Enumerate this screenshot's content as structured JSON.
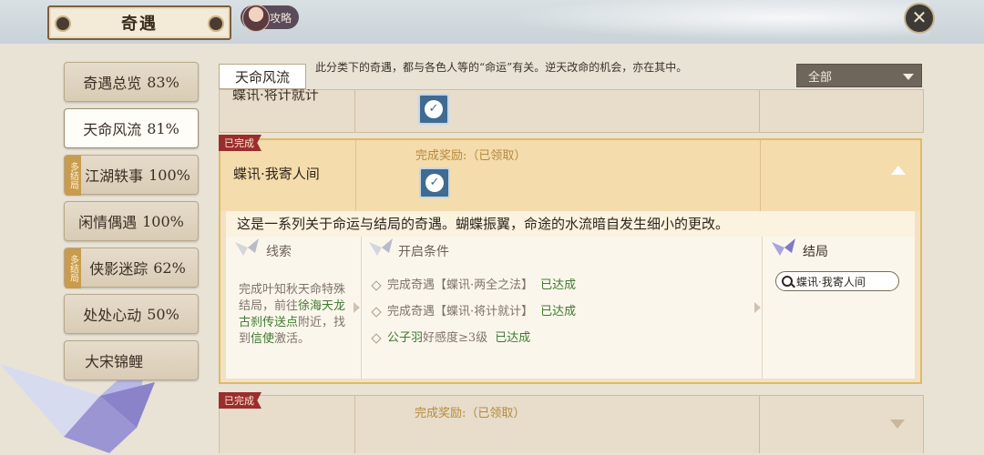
{
  "window": {
    "title": "奇遇",
    "guide_label": "攻略",
    "close_label": "✕"
  },
  "categories": [
    {
      "label": "奇遇总览",
      "pct": "83%",
      "tag": ""
    },
    {
      "label": "天命风流",
      "pct": "81%",
      "tag": "",
      "active": true
    },
    {
      "label": "江湖轶事",
      "pct": "100%",
      "tag": "多结局"
    },
    {
      "label": "闲情偶遇",
      "pct": "100%",
      "tag": ""
    },
    {
      "label": "侠影迷踪",
      "pct": "62%",
      "tag": "多结局"
    },
    {
      "label": "处处心动",
      "pct": "50%",
      "tag": ""
    },
    {
      "label": "大宋锦鲤",
      "pct": "",
      "tag": ""
    }
  ],
  "header": {
    "category_label": "天命风流",
    "description": "此分类下的奇遇，都与各色人等的“命运”有关。逆天改命的机会，亦在其中。",
    "filter_value": "全部"
  },
  "entries": {
    "prev": {
      "name": "蝶讯·将计就计"
    },
    "current": {
      "status": "已完成",
      "name": "蝶讯·我寄人间",
      "reward": "完成奖励:（已领取）",
      "summary": "这是一系列关于命运与结局的奇遇。蝴蝶振翼，命途的水流暗自发生细小的更改。",
      "clue_heading": "线索",
      "clue_text_1": "完成叶知秋天命特殊结局，前往",
      "clue_place": "徐海天龙古刹传送点",
      "clue_text_2": "附近，找到",
      "clue_npc": "信使",
      "clue_text_3": "激活。",
      "conditions_heading": "开启条件",
      "conditions": [
        {
          "prefix": "完成奇遇【蝶讯·两全之法】",
          "state": "已达成"
        },
        {
          "prefix": "完成奇遇【蝶讯·将计就计】",
          "state": "已达成"
        },
        {
          "npc": "公子羽",
          "prefix": "好感度≥3级",
          "state": "已达成"
        }
      ],
      "ending_heading": "结局",
      "ending_value": "蝶讯·我寄人间"
    },
    "next": {
      "status": "已完成",
      "reward": "完成奖励:（已领取）"
    }
  }
}
